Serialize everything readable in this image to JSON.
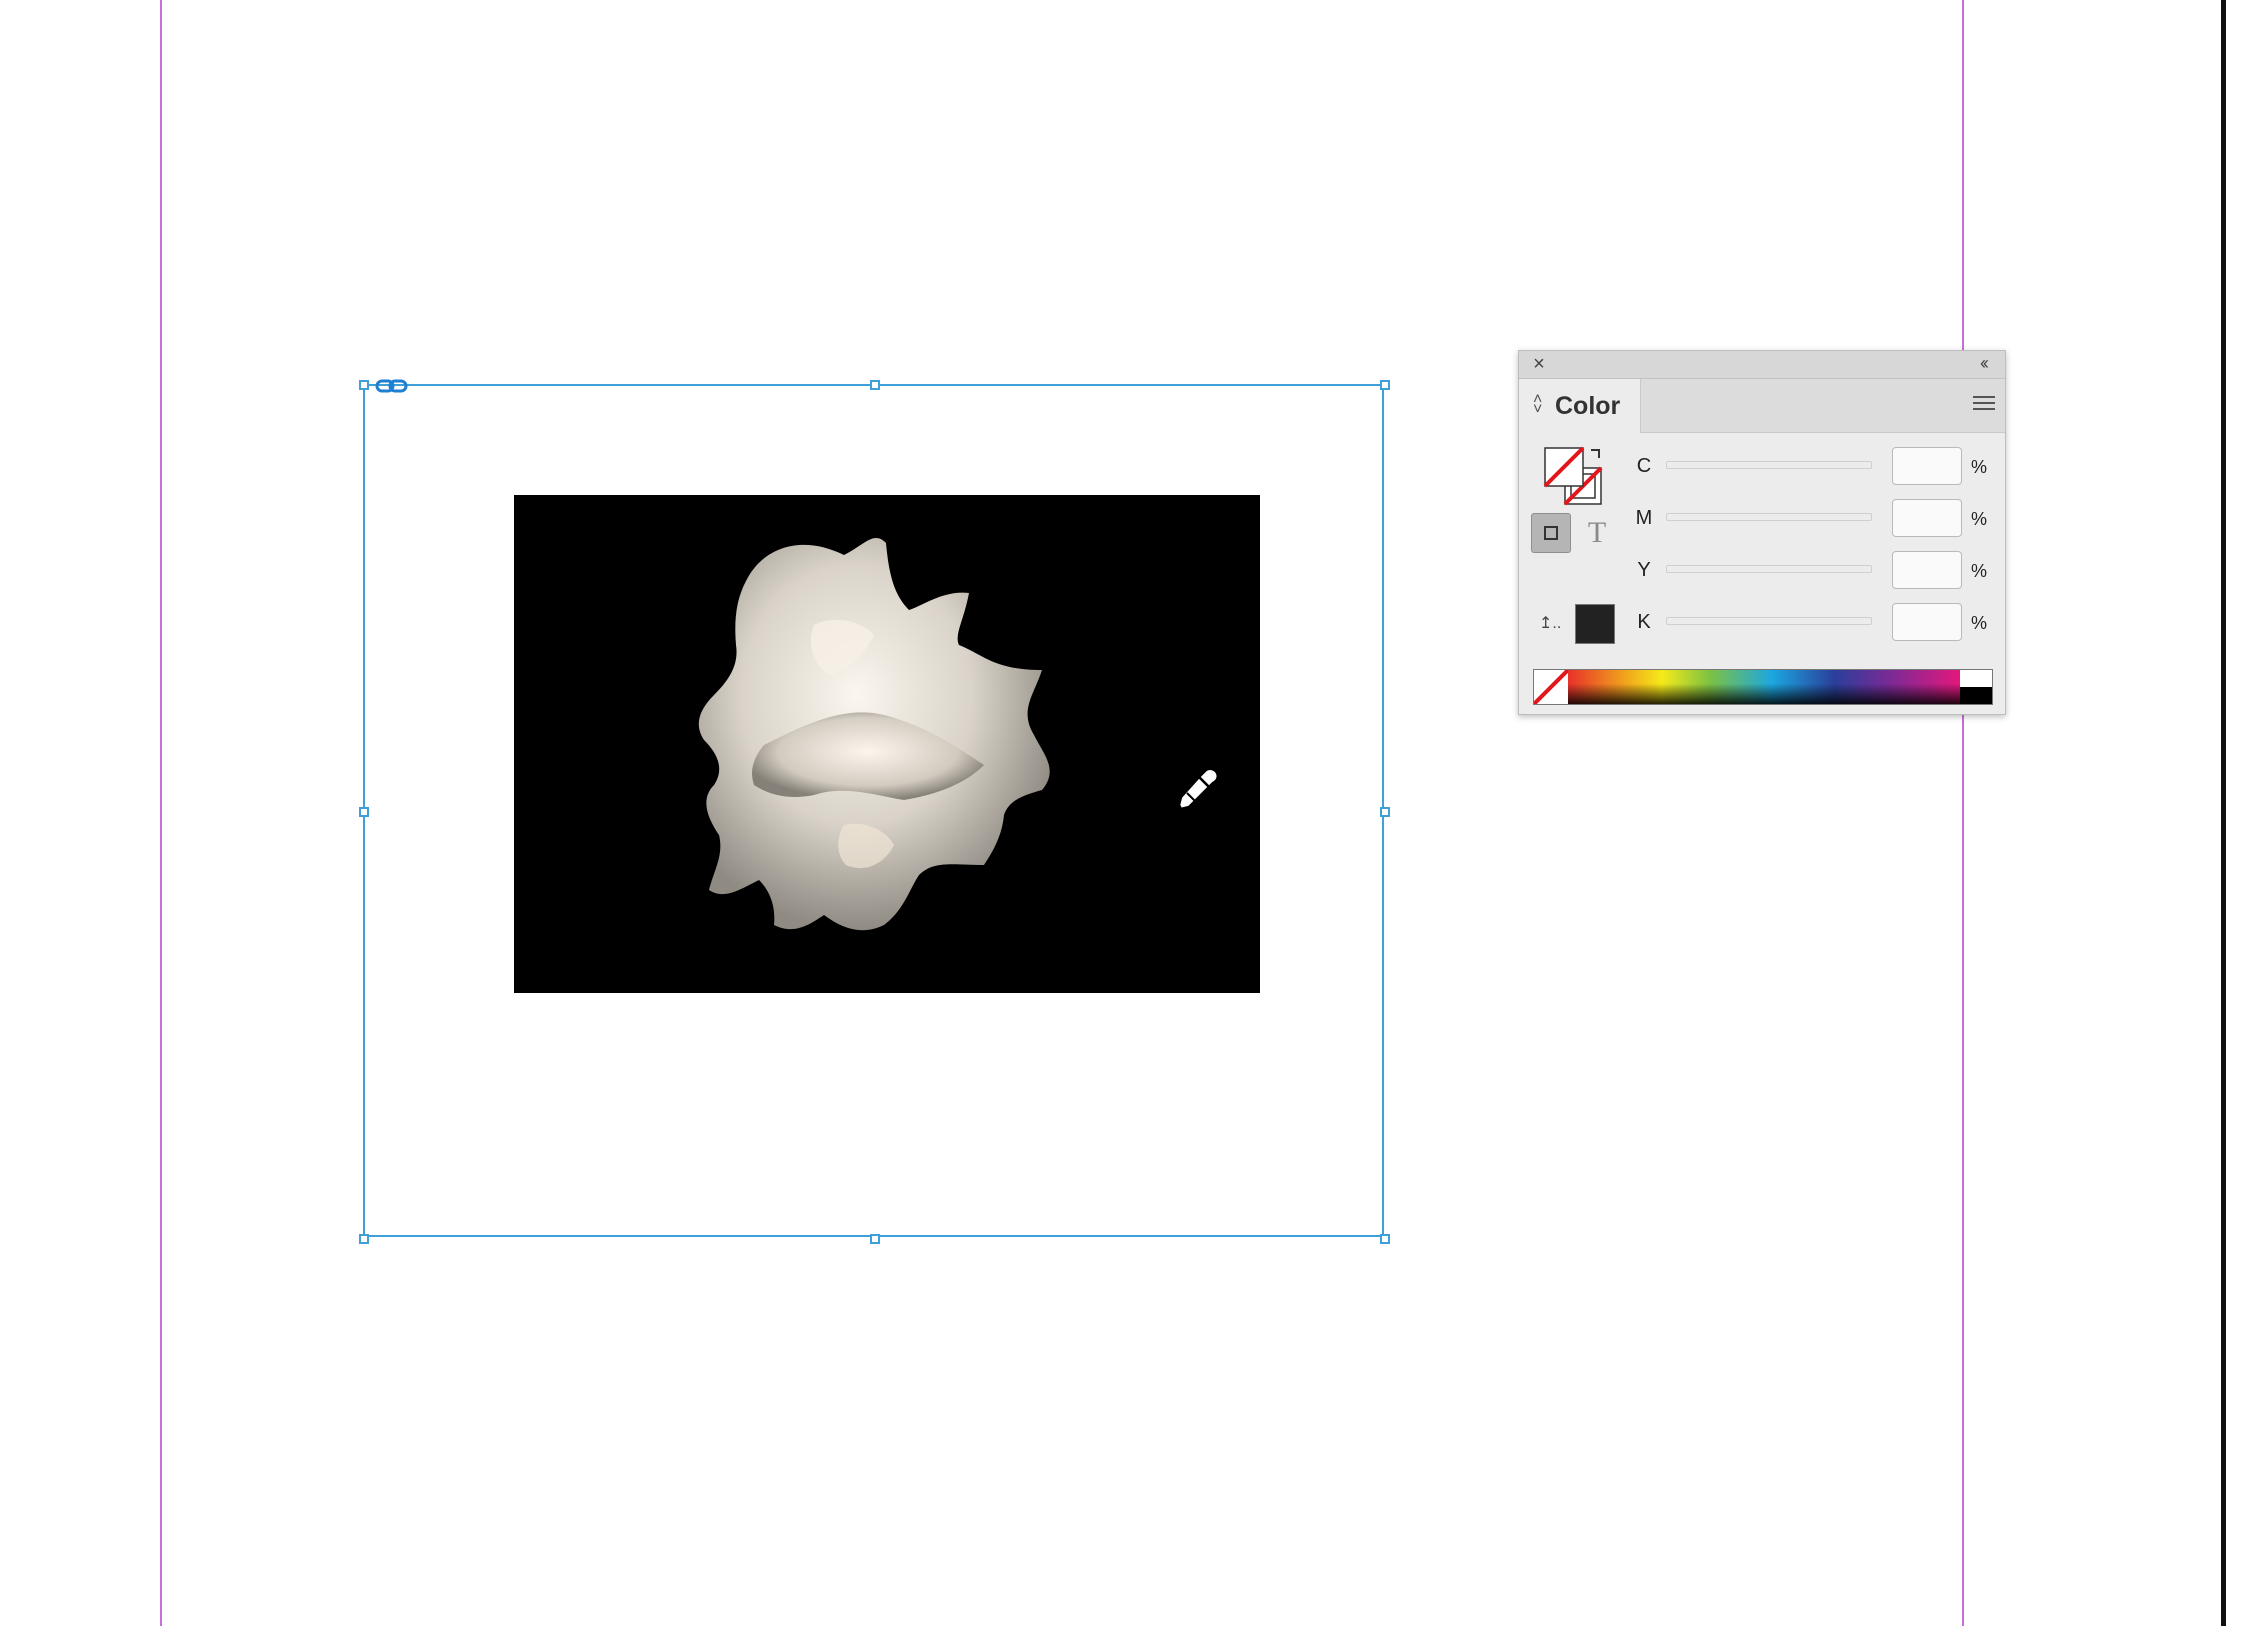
{
  "color_panel": {
    "title": "Color",
    "close_glyph": "×",
    "collapse_glyph": "‹‹",
    "text_mode_glyph": "T",
    "oog_glyph": "↥..",
    "channels": [
      {
        "label": "C",
        "value": "",
        "unit": "%"
      },
      {
        "label": "M",
        "value": "",
        "unit": "%"
      },
      {
        "label": "Y",
        "value": "",
        "unit": "%"
      },
      {
        "label": "K",
        "value": "",
        "unit": "%"
      }
    ],
    "last_color_hex": "#222222"
  },
  "colors": {
    "margin_guide": "#c66ed9",
    "frame_selection": "#3ea0d6",
    "none_swatch_slash": "#e3161b"
  },
  "icons": [
    "link-icon",
    "eyedropper-icon",
    "close-icon",
    "collapse-icon",
    "panel-menu-icon",
    "swap-icon"
  ]
}
